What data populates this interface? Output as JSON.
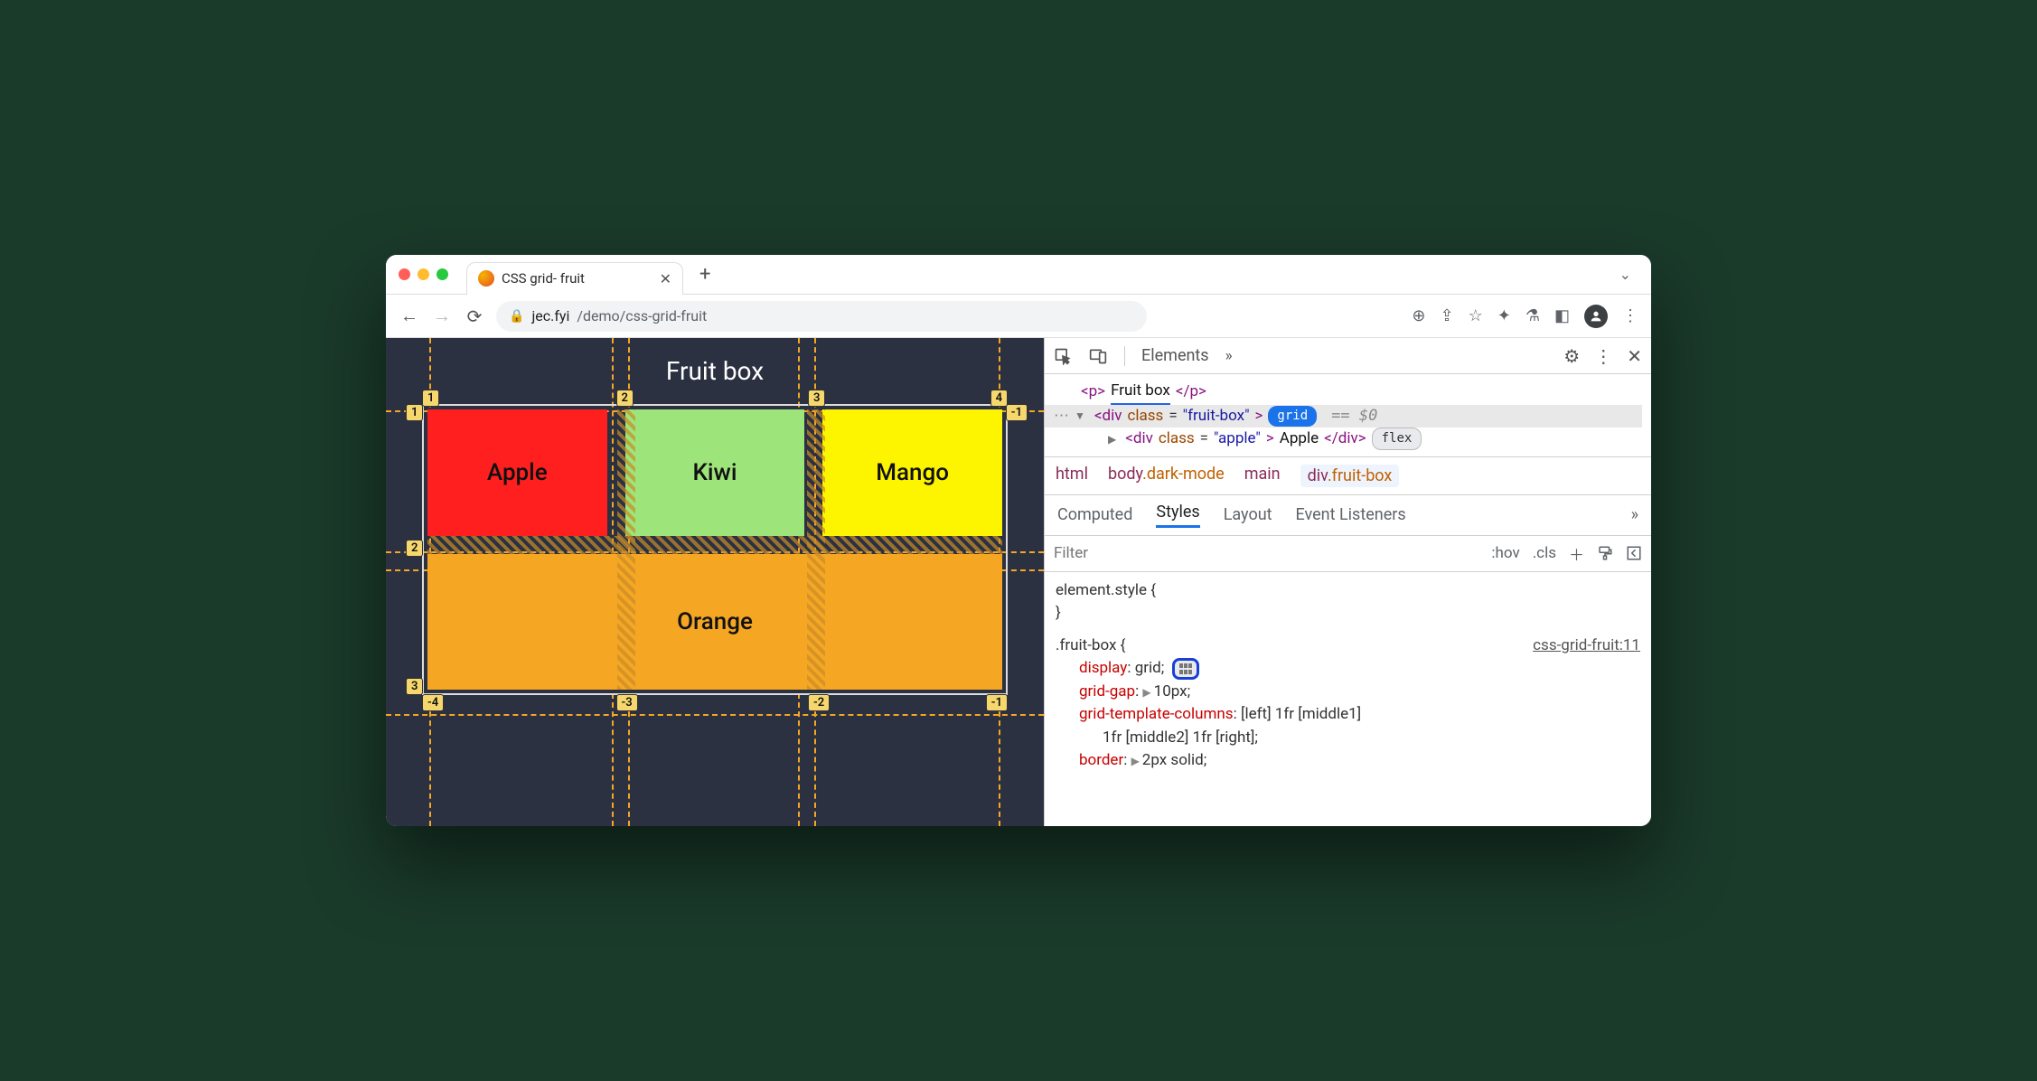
{
  "browser": {
    "tab_title": "CSS grid- fruit",
    "url_host": "jec.fyi",
    "url_path": "/demo/css-grid-fruit"
  },
  "page": {
    "heading": "Fruit box",
    "cells": {
      "apple": "Apple",
      "kiwi": "Kiwi",
      "mango": "Mango",
      "orange": "Orange"
    },
    "grid_lines": {
      "col_pos": [
        "1",
        "2",
        "3",
        "4"
      ],
      "col_neg": [
        "-4",
        "-3",
        "-2",
        "-1"
      ],
      "row_pos": [
        "1",
        "2",
        "3"
      ],
      "row_neg": [
        "-1"
      ]
    }
  },
  "devtools": {
    "main_tab": "Elements",
    "dom": {
      "p_text": "Fruit box",
      "div_class": "fruit-box",
      "div_badge": "grid",
      "eq0": "== $0",
      "child_class": "apple",
      "child_text": "Apple",
      "child_badge": "flex"
    },
    "crumbs": [
      "html",
      "body",
      ".dark-mode",
      "main",
      "div",
      ".fruit-box"
    ],
    "subtabs": [
      "Computed",
      "Styles",
      "Layout",
      "Event Listeners"
    ],
    "filter_placeholder": "Filter",
    "filter_actions": [
      ":hov",
      ".cls"
    ],
    "styles": {
      "element_style": "element.style {",
      "close_brace": "}",
      "rule_selector": ".fruit-box {",
      "rule_source": "css-grid-fruit:11",
      "props": [
        {
          "name": "display",
          "value": "grid;",
          "has_grid_badge": true
        },
        {
          "name": "grid-gap",
          "value": "10px;",
          "expandable": true
        },
        {
          "name": "grid-template-columns",
          "value": "[left] 1fr [middle1]"
        },
        {
          "name": "",
          "value": "1fr [middle2] 1fr [right];",
          "indent": true
        },
        {
          "name": "border",
          "value": "2px solid;",
          "expandable": true
        }
      ]
    }
  }
}
